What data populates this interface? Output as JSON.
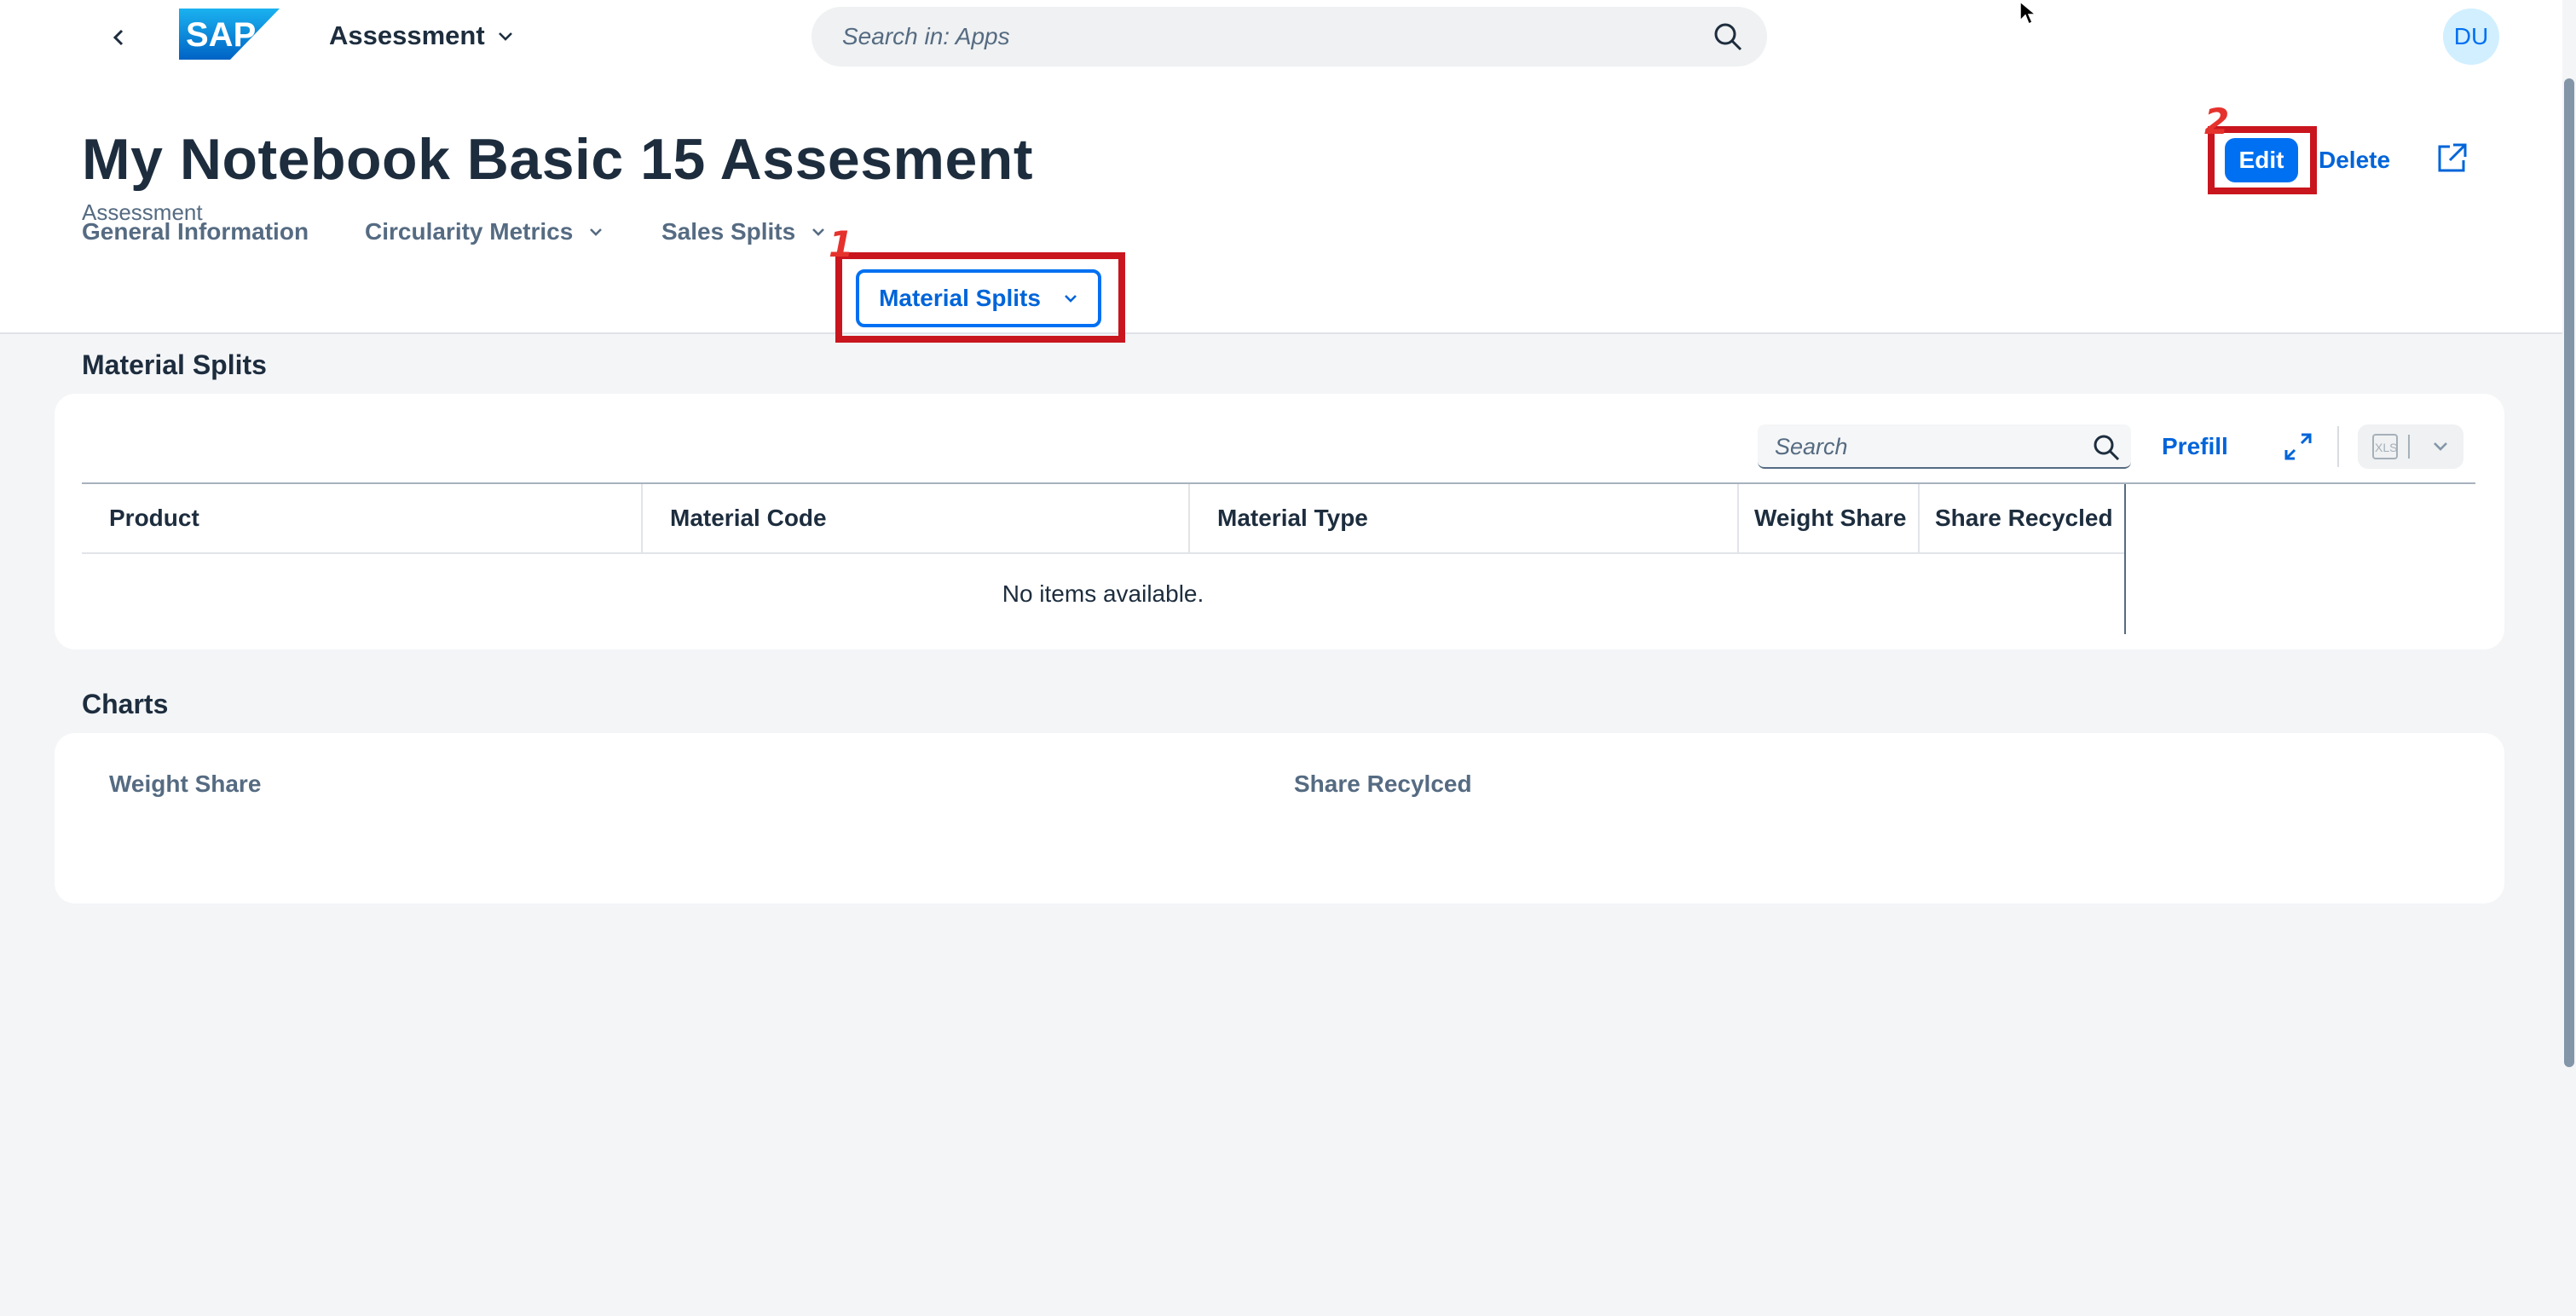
{
  "shell": {
    "app_title": "Assessment",
    "search_placeholder": "Search in: Apps",
    "avatar_initials": "DU",
    "logo_text": "SAP"
  },
  "header": {
    "title": "My Notebook Basic 15 Assesment",
    "subtitle": "Assessment",
    "actions": {
      "edit": "Edit",
      "delete": "Delete"
    }
  },
  "annotations": [
    "1",
    "2"
  ],
  "tabs": [
    {
      "label": "General Information",
      "has_menu": false
    },
    {
      "label": "Circularity Metrics",
      "has_menu": true
    },
    {
      "label": "Sales Splits",
      "has_menu": true
    },
    {
      "label": "Material Splits",
      "has_menu": true,
      "selected": true
    }
  ],
  "material_splits": {
    "section_title": "Material Splits",
    "toolbar": {
      "search_placeholder": "Search",
      "prefill": "Prefill",
      "export_icon_text": "XLS"
    },
    "columns": [
      "Product",
      "Material Code",
      "Material Type",
      "Weight Share",
      "Share Recycled"
    ],
    "empty_text": "No items available."
  },
  "charts": {
    "section_title": "Charts",
    "items": [
      "Weight Share",
      "Share Recylced"
    ]
  },
  "colors": {
    "brand": "#0070f2",
    "link": "#0064d9",
    "annotation": "#c9151e"
  }
}
